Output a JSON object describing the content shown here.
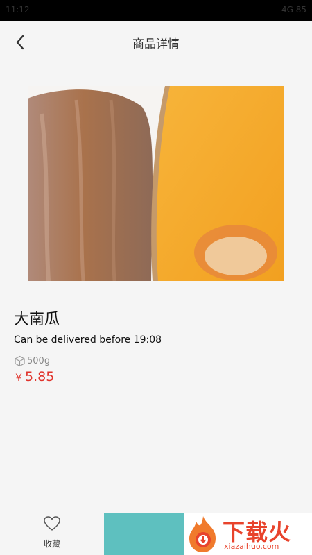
{
  "status_bar": {
    "time": "11:12",
    "right": "4G 85"
  },
  "header": {
    "title": "商品详情",
    "back_icon": "chevron-left-icon"
  },
  "product": {
    "name": "大南瓜",
    "delivery": "Can be delivered before 19:08",
    "weight": "500g",
    "currency": "￥",
    "price": "5.85"
  },
  "bottom_bar": {
    "favorite_label": "收藏",
    "favorite_icon": "heart-icon"
  },
  "watermark": {
    "brand": "下载火",
    "url": "xiazaihuo.com"
  },
  "colors": {
    "price": "#e0342c",
    "cart": "#5ec0bf",
    "watermark": "#e8432c"
  }
}
